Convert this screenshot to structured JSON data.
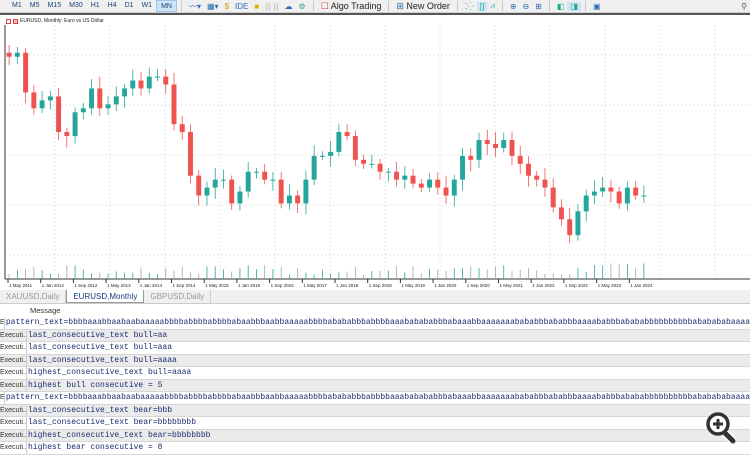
{
  "toolbar": {
    "timeframes": [
      "M1",
      "M5",
      "M15",
      "M30",
      "H1",
      "H4",
      "D1",
      "W1",
      "MN"
    ],
    "active_timeframe": "MN",
    "algo_trading": "Algo Trading",
    "new_order": "New Order"
  },
  "chart": {
    "title": "EURUSD, Monthly: Euro vs US Dollar",
    "bull_color": "#26a69a",
    "bear_color": "#ef5350"
  },
  "chart_data": {
    "type": "candlestick",
    "symbol": "EURUSD",
    "timeframe": "Monthly",
    "x_ticks": [
      "1 May 2011",
      "1 Jan 2012",
      "1 Sep 2012",
      "1 May 2013",
      "1 Jan 2014",
      "1 Sep 2014",
      "1 May 2015",
      "1 Jan 2016",
      "1 Sep 2016",
      "1 May 2017",
      "1 Jan 2018",
      "1 Sep 2018",
      "1 May 2019",
      "1 Jan 2020",
      "1 Sep 2020",
      "1 May 2021",
      "1 Jan 2022",
      "1 Sep 2022",
      "1 May 2023",
      "1 Jan 2024"
    ],
    "closes": [
      1.43,
      1.44,
      1.34,
      1.3,
      1.32,
      1.33,
      1.24,
      1.23,
      1.29,
      1.3,
      1.35,
      1.3,
      1.31,
      1.33,
      1.35,
      1.37,
      1.35,
      1.38,
      1.38,
      1.36,
      1.26,
      1.24,
      1.13,
      1.08,
      1.1,
      1.12,
      1.12,
      1.06,
      1.09,
      1.14,
      1.14,
      1.12,
      1.12,
      1.06,
      1.08,
      1.06,
      1.12,
      1.18,
      1.18,
      1.19,
      1.24,
      1.23,
      1.17,
      1.16,
      1.16,
      1.14,
      1.14,
      1.12,
      1.13,
      1.11,
      1.1,
      1.12,
      1.1,
      1.08,
      1.12,
      1.18,
      1.17,
      1.22,
      1.21,
      1.2,
      1.22,
      1.18,
      1.16,
      1.13,
      1.12,
      1.1,
      1.05,
      1.02,
      0.98,
      1.04,
      1.08,
      1.09,
      1.1,
      1.09,
      1.06,
      1.1,
      1.08,
      1.08
    ],
    "ylim": [
      0.94,
      1.5
    ],
    "grid": true
  },
  "tabs": [
    {
      "label": "XAUUSD,Daily"
    },
    {
      "label": "EURUSD,Monthly",
      "active": true
    },
    {
      "label": "GBPUSD,Daily"
    }
  ],
  "log": {
    "header": "Message",
    "source": "Executi...",
    "rows": [
      "pattern_text=bbbbaaabbaabaabaaaaabbbbabbbbabbbbabaabbbaabbaaaaabbbbabababbbabbbbaaababababbbabaaabbaaaaaaabababbbababbbaaaababbbabababbbbbbbbbbababababaaaa",
      "last_consecutive_text bull=aa",
      "last_consecutive_text bull=aaa",
      "last_consecutive_text bull=aaaa",
      "highest_consecutive_text bull=aaaa",
      "highest bull consecutive = 5",
      "pattern_text=bbbbaaabbaabaabaaaaabbbbabbbbabbbbabaabbbaabbaaaaabbbbabababbbabbbbaaababababbbabaaabbaaaaaaabababbbababbbaaaababbbabababbbbbbbbbbababababaaaa",
      "last_consecutive_text bear=bbb",
      "last_consecutive_text bear=bbbbbbbb",
      "highest_consecutive_text bear=bbbbbbbb",
      "highest bear consecutive = 8"
    ]
  }
}
